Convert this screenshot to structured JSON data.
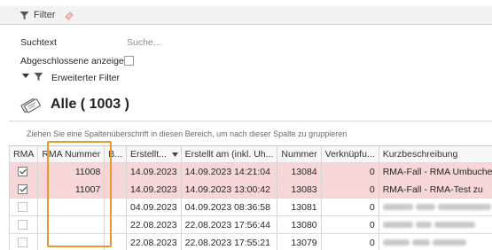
{
  "filter": {
    "title": "Filter",
    "search_label": "Suchtext",
    "search_placeholder": "Suche...",
    "show_closed_label": "Abgeschlossene anzeigen",
    "extended_filter_label": "Erweiterter Filter"
  },
  "header": {
    "title": "Alle ( 1003 )"
  },
  "grid": {
    "group_hint": "Ziehen Sie eine Spaltenüberschrift in diesen Bereich, um nach dieser Spalte zu gruppieren",
    "columns": [
      "RMA",
      "RMA Nummer",
      "B...",
      "Erstellt...",
      "Erstellt am (inkl. Uh...",
      "Nummer",
      "Verknüpfu...",
      "Kurzbeschreibung"
    ],
    "rows": [
      {
        "rma": true,
        "rma_nummer": "11008",
        "b": "",
        "erstellt": "14.09.2023",
        "erstellt_uhr": "14.09.2023 14:21:04",
        "nummer": "13084",
        "verkn": "0",
        "kurz": "RMA-Fall - RMA Umbuchen-T",
        "highlight": true,
        "current": false
      },
      {
        "rma": true,
        "rma_nummer": "11007",
        "b": "",
        "erstellt": "14.09.2023",
        "erstellt_uhr": "14.09.2023 13:00:42",
        "nummer": "13083",
        "verkn": "0",
        "kurz": "RMA-Fall - RMA-Test zu",
        "highlight": true,
        "current": false
      },
      {
        "rma": false,
        "rma_nummer": "",
        "b": "",
        "erstellt": "04.09.2023",
        "erstellt_uhr": "04.09.2023 08:36:58",
        "nummer": "13081",
        "verkn": "0",
        "kurz": "",
        "highlight": false,
        "current": false
      },
      {
        "rma": false,
        "rma_nummer": "",
        "b": "",
        "erstellt": "22.08.2023",
        "erstellt_uhr": "22.08.2023 17:56:44",
        "nummer": "13080",
        "verkn": "0",
        "kurz": "",
        "highlight": false,
        "current": true
      },
      {
        "rma": false,
        "rma_nummer": "",
        "b": "",
        "erstellt": "22.08.2023",
        "erstellt_uhr": "22.08.2023 17:55:21",
        "nummer": "13079",
        "verkn": "0",
        "kurz": "",
        "highlight": false,
        "current": false
      }
    ]
  },
  "colors": {
    "highlight_row": "#f6d6d6",
    "annotation_box": "#e8982e"
  },
  "icons": {
    "filter": "funnel-icon",
    "clear_filter": "eraser-icon",
    "header": "tickets-icon",
    "sort": "sort-down-icon"
  }
}
